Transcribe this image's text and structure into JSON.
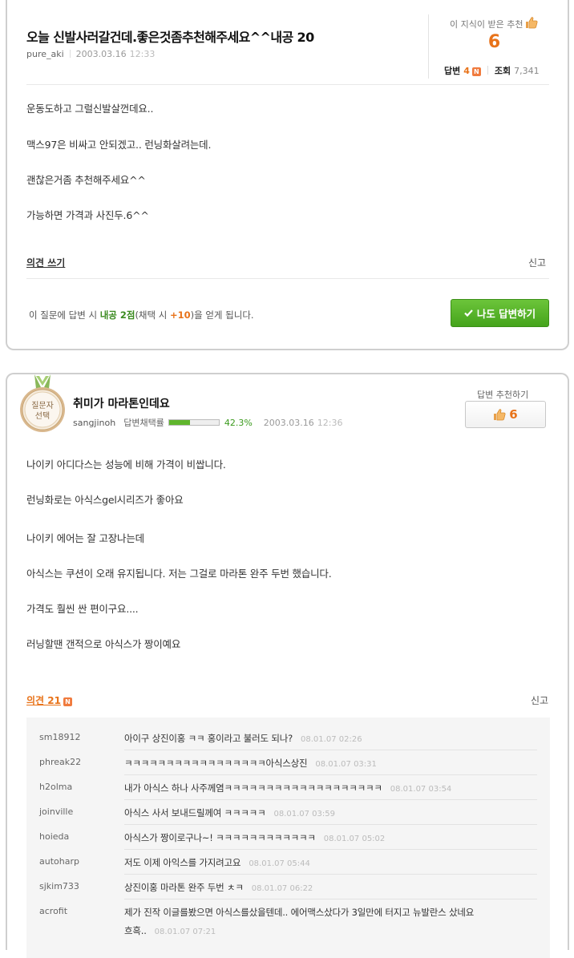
{
  "question": {
    "title": "오늘 신발사러갈건데.좋은것좀추천해주세요^^내공 20",
    "author": "pure_aki",
    "date": "2003.03.16",
    "time": "12:33",
    "recommend_label": "이 지식이 받은 추천",
    "recommend_count": "6",
    "answers_label": "답변",
    "answers_count": "4",
    "views_label": "조회",
    "views_count": "7,341",
    "new_badge": "N",
    "body": [
      "운동도하고 그럴신발살껀데요..",
      "맥스97은 비싸고 안되겠고.. 런닝화살려는데.",
      "괜찮은거좀 추천해주세요^^",
      "가능하면 가격과 사진두.6^^"
    ],
    "opinion_write": "의견 쓰기",
    "report": "신고",
    "notice": {
      "part1": "이 질문에 답변 시 ",
      "points": "내공 2점",
      "part2": "(채택 시 ",
      "bonus": "+10",
      "part3": ")을 얻게 됩니다."
    },
    "answer_button": "나도 답변하기"
  },
  "answer": {
    "badge_line1": "질문자",
    "badge_line2": "선택",
    "title": "취미가 마라톤인데요",
    "author": "sangjinoh",
    "rate_label": "답변채택률",
    "rate_percent": "42.3%",
    "rate_value": 42.3,
    "date": "2003.03.16",
    "time": "12:36",
    "recommend_label": "답변 추천하기",
    "recommend_count": "6",
    "body": [
      "나이키 아디다스는 성능에 비해 가격이 비쌉니다.",
      "런닝화로는 아식스gel시리즈가 좋아요",
      "나이키 에어는 잘 고장나는데",
      "아식스는 쿠션이 오래 유지됩니다. 저는 그걸로 마라톤 완주 두번 했습니다.",
      "가격도 훨씬 싼 편이구요....",
      "러닝할땐 갠적으로 아식스가 짱이예요"
    ],
    "opinion_label": "의견 21",
    "new_badge": "N",
    "report": "신고"
  },
  "comments": [
    {
      "user": "sm18912",
      "text": "아이구 상진이홍 ㅋㅋ 홍이라고 불러도 되나?",
      "ts": "08.01.07 02:26"
    },
    {
      "user": "phreak22",
      "text": "ㅋㅋㅋㅋㅋㅋㅋㅋㅋㅋㅋㅋㅋㅋㅋㅋㅋ아식스상진",
      "ts": "08.01.07 03:31"
    },
    {
      "user": "h2olma",
      "text": "내가 아식스 하나 사주께염ㅋㅋㅋㅋㅋㅋㅋㅋㅋㅋㅋㅋㅋㅋㅋㅋㅋㅋㅋ",
      "ts": "08.01.07 03:54"
    },
    {
      "user": "joinville",
      "text": "아식스 사서 보내드릴께여 ㅋㅋㅋㅋㅋ",
      "ts": "08.01.07 03:59"
    },
    {
      "user": "hoieda",
      "text": "아식스가 짱이로구나~! ㅋㅋㅋㅋㅋㅋㅋㅋㅋㅋㅋㅋ",
      "ts": "08.01.07 05:02"
    },
    {
      "user": "autoharp",
      "text": "저도 이제 아익스를 가지려고요",
      "ts": "08.01.07 05:44"
    },
    {
      "user": "sjkim733",
      "text": "상진이홍 마라톤 완주 두번 ㅊㅋ",
      "ts": "08.01.07 06:22"
    },
    {
      "user": "acrofit",
      "text": "제가 진작 이글를봤으면 아식스를샀을텐데.. 에어맥스샀다가 3일만에 터지고 뉴발란스 샀네요",
      "text2": "흐흑..",
      "ts": "08.01.07 07:21"
    }
  ],
  "colors": {
    "accent_orange": "#e8731a",
    "accent_green": "#45a41c",
    "border": "#cfcfcf"
  }
}
